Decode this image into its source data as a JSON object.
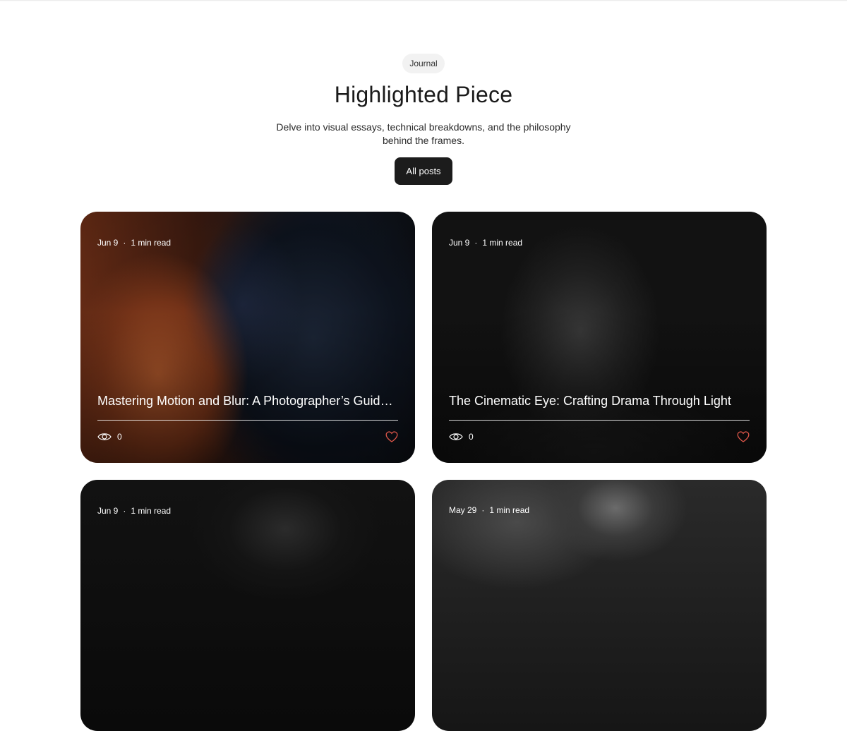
{
  "header": {
    "chip_label": "Journal",
    "title": "Highlighted Piece",
    "subtitle": "Delve into visual essays, technical breakdowns, and the philosophy behind the frames.",
    "all_posts_label": "All posts"
  },
  "posts": [
    {
      "date": "Jun 9",
      "read_time": "1 min read",
      "title": "Mastering Motion and Blur: A Photographer’s Guide to Dynamic Shots",
      "views": "0"
    },
    {
      "date": "Jun 9",
      "read_time": "1 min read",
      "title": "The Cinematic Eye: Crafting Drama Through Light",
      "views": "0"
    },
    {
      "date": "Jun 9",
      "read_time": "1 min read"
    },
    {
      "date": "May 29",
      "read_time": "1 min read"
    }
  ],
  "colors": {
    "accent_like": "#e0574a",
    "button_bg": "#1c1c1c",
    "chip_bg": "#f2f2f2"
  },
  "icons": {
    "views": "eye-icon",
    "like": "heart-icon"
  }
}
